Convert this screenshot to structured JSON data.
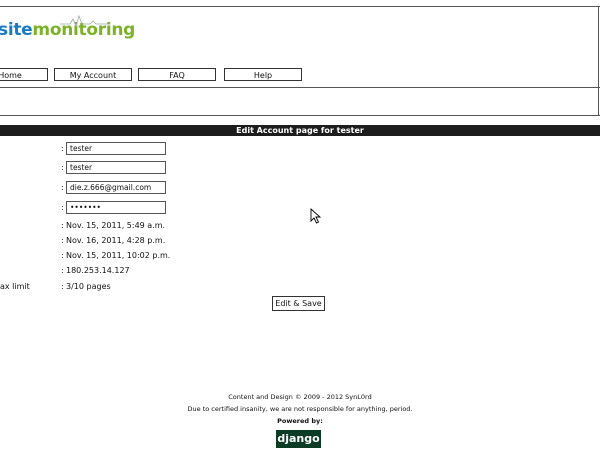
{
  "logo": {
    "part1": "site",
    "part2": "monitoring"
  },
  "nav": [
    {
      "label": "Home"
    },
    {
      "label": "My Account"
    },
    {
      "label": "FAQ"
    },
    {
      "label": "Help"
    }
  ],
  "page_title": "Edit Account page for tester",
  "fields": {
    "username": "tester",
    "name": "tester",
    "email": "die.z.666@gmail.com",
    "password": "•••••••"
  },
  "info": {
    "date1": "Nov. 15, 2011, 5:49 a.m.",
    "date2": "Nov. 16, 2011, 4:28 p.m.",
    "date3": "Nov. 15, 2011, 10:02 p.m.",
    "ip": "180.253.14.127",
    "max_limit_label": "ax limit",
    "max_limit_value": "3/10 pages"
  },
  "colon": ":",
  "edit_button": "Edit & Save",
  "footer": {
    "line1": "Content and Design © 2009 - 2012 SynL0rd",
    "line2": "Due to certified insanity, we are not responsible for anything, period.",
    "line3": "Powered by:",
    "badge": "django"
  }
}
